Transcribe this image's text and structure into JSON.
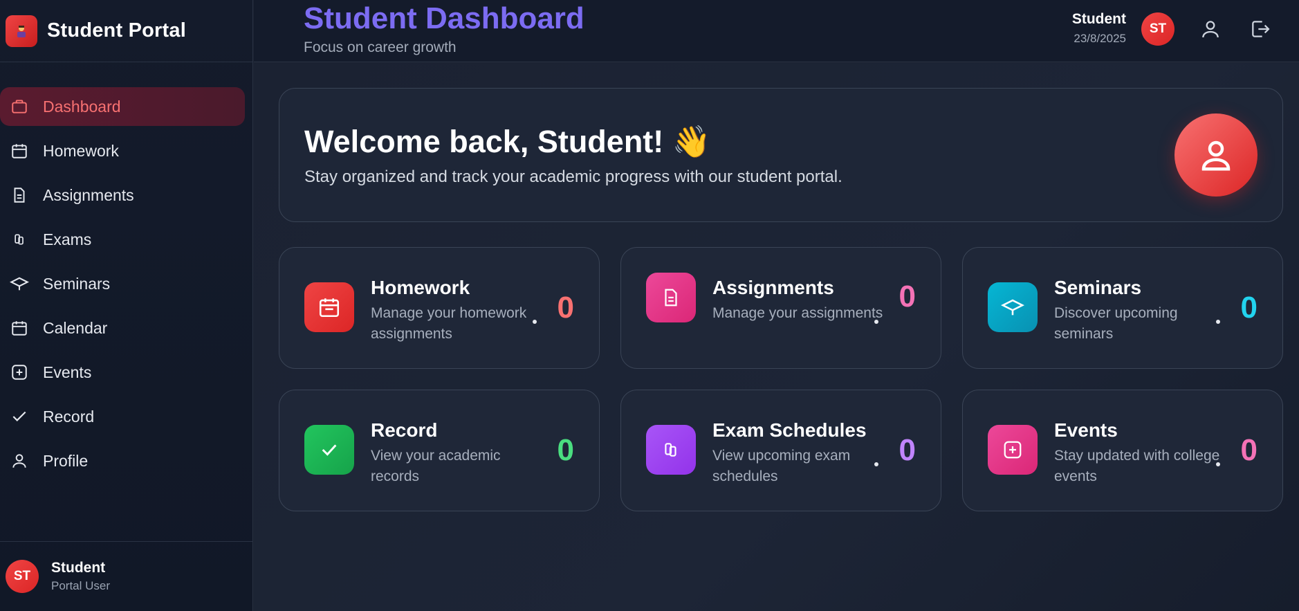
{
  "sidebar": {
    "brand_title": "Student Portal",
    "items": [
      {
        "label": "Dashboard",
        "icon": "briefcase-icon",
        "active": true
      },
      {
        "label": "Homework",
        "icon": "calendar-icon"
      },
      {
        "label": "Assignments",
        "icon": "document-icon"
      },
      {
        "label": "Exams",
        "icon": "copy-icon"
      },
      {
        "label": "Seminars",
        "icon": "graduation-cap-icon"
      },
      {
        "label": "Calendar",
        "icon": "calendar-icon"
      },
      {
        "label": "Events",
        "icon": "plus-square-icon"
      },
      {
        "label": "Record",
        "icon": "check-icon"
      },
      {
        "label": "Profile",
        "icon": "user-icon"
      }
    ],
    "footer": {
      "initials": "ST",
      "name": "Student",
      "role": "Portal User"
    }
  },
  "header": {
    "title": "Student Dashboard",
    "subtitle": "Focus on career growth",
    "user_name": "Student",
    "date": "23/8/2025",
    "initials": "ST"
  },
  "welcome": {
    "title": "Welcome back, Student! 👋",
    "subtitle": "Stay organized and track your academic progress with our student portal."
  },
  "cards": [
    {
      "title": "Homework",
      "desc": "Manage your homework assignments",
      "count": "0",
      "color": "#f87171",
      "icon": "calendar-icon"
    },
    {
      "title": "Assignments",
      "desc": "Manage your assignments",
      "count": "0",
      "color": "#f472b6",
      "icon": "document-icon"
    },
    {
      "title": "Seminars",
      "desc": "Discover upcoming seminars",
      "count": "0",
      "color": "#22d3ee",
      "icon": "graduation-cap-icon"
    },
    {
      "title": "Record",
      "desc": "View your academic records",
      "count": "0",
      "color": "#4ade80",
      "icon": "check-icon"
    },
    {
      "title": "Exam Schedules",
      "desc": "View upcoming exam schedules",
      "count": "0",
      "color": "#c084fc",
      "icon": "copy-icon"
    },
    {
      "title": "Events",
      "desc": "Stay updated with college events",
      "count": "0",
      "color": "#f472b6",
      "icon": "plus-square-icon"
    }
  ],
  "colors": {
    "accent_red": "#ef4444",
    "title_purple": "#7c6cf2",
    "active_nav_bg": "#5a1b2f"
  }
}
